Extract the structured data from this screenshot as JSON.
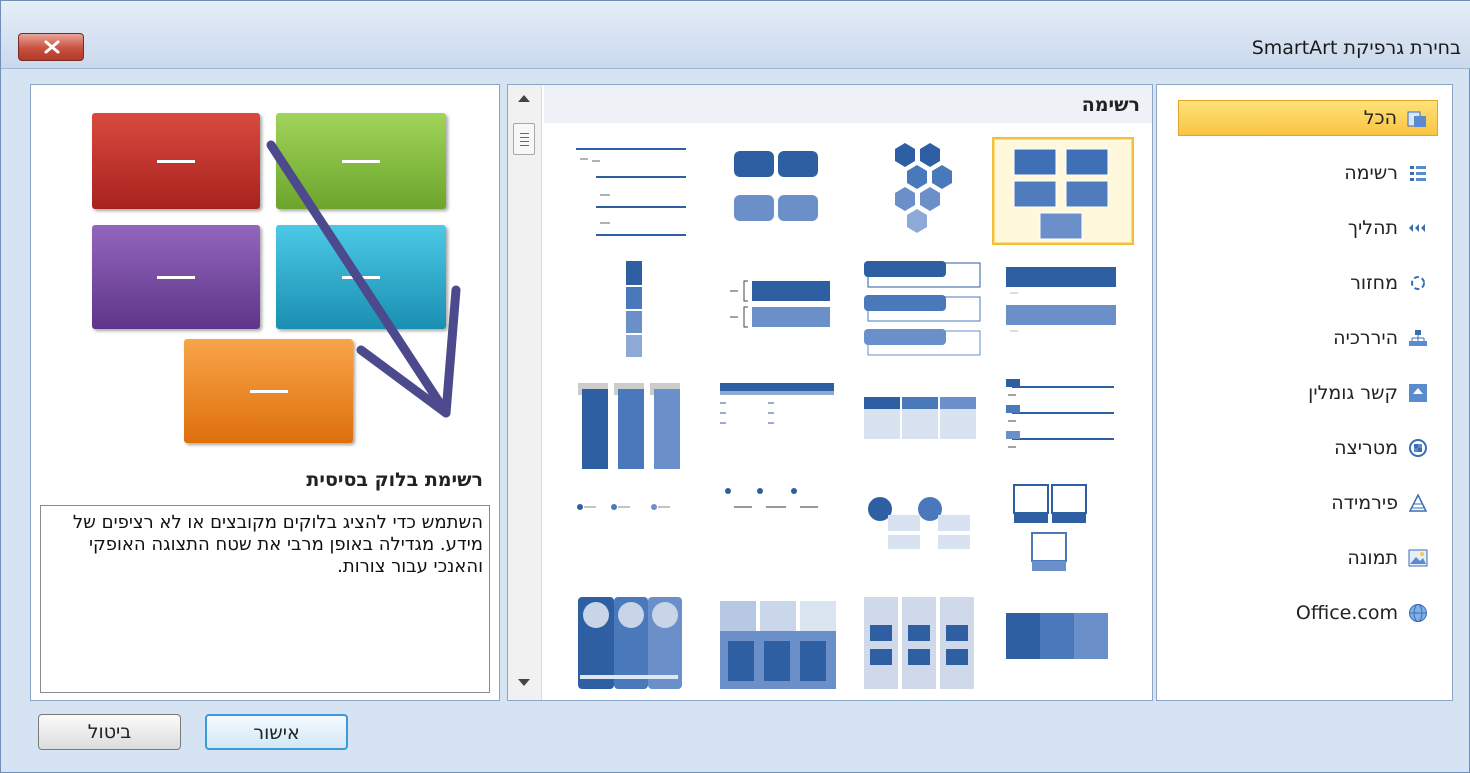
{
  "window": {
    "title": "בחירת גרפיקת SmartArt",
    "close_icon": "close-icon"
  },
  "categories": [
    {
      "label": "הכל",
      "icon": "all-icon",
      "selected": true
    },
    {
      "label": "רשימה",
      "icon": "list-icon"
    },
    {
      "label": "תהליך",
      "icon": "process-icon"
    },
    {
      "label": "מחזור",
      "icon": "cycle-icon"
    },
    {
      "label": "היררכיה",
      "icon": "hierarchy-icon"
    },
    {
      "label": "קשר גומלין",
      "icon": "relationship-icon"
    },
    {
      "label": "מטריצה",
      "icon": "matrix-icon"
    },
    {
      "label": "פירמידה",
      "icon": "pyramid-icon"
    },
    {
      "label": "תמונה",
      "icon": "picture-icon"
    },
    {
      "label": "Office.com",
      "icon": "globe-icon"
    }
  ],
  "gallery": {
    "title": "רשימה",
    "selected_index": 0
  },
  "preview": {
    "name": "רשימת בלוק בסיסית",
    "description": "השתמש כדי להציג בלוקים מקובצים או לא רציפים של מידע. מגדילה באופן מרבי את שטח התצוגה האופקי והאנכי עבור צורות.",
    "colors": {
      "red": "#c9302c",
      "green": "#8cc63f",
      "purple": "#7f4fa8",
      "cyan": "#2cb6d6",
      "orange": "#f08a1c"
    }
  },
  "buttons": {
    "ok": "אישור",
    "cancel": "ביטול"
  },
  "colors": {
    "selection": "#f9c440",
    "tile_blue": "#2e5fa3",
    "dialog_bg": "#d6e3f2"
  }
}
